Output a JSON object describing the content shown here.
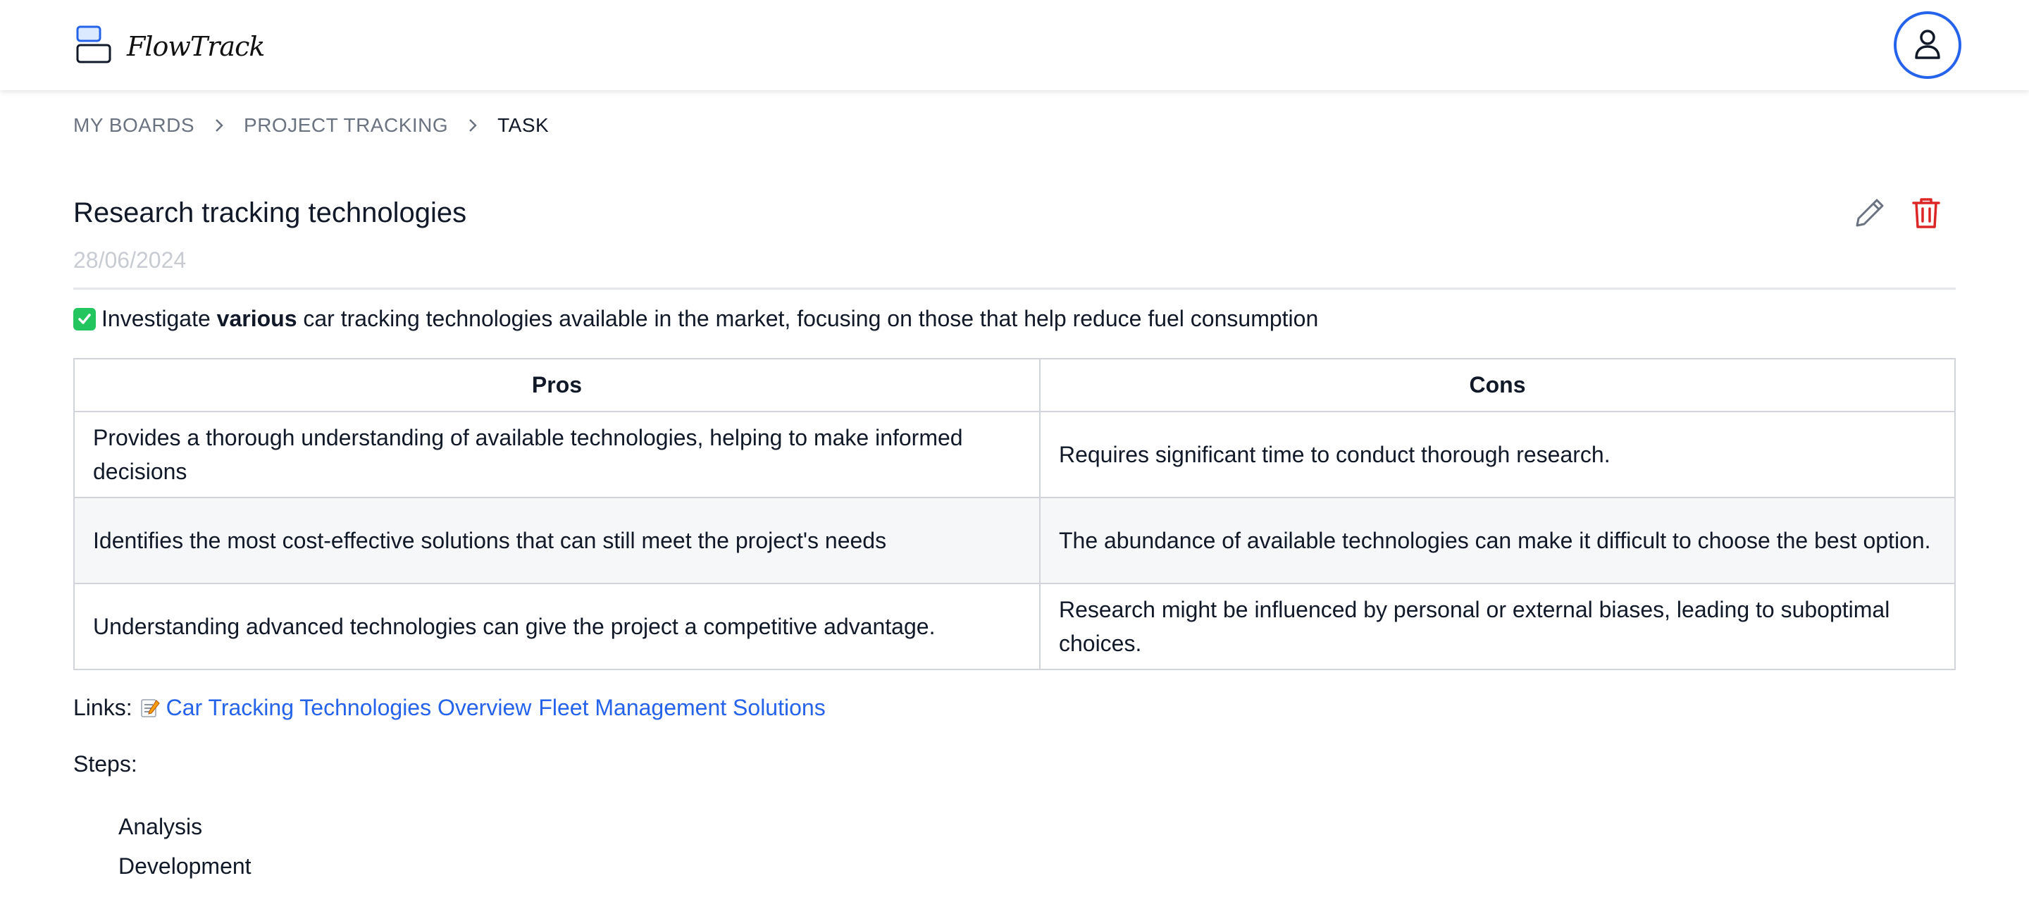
{
  "app": {
    "name": "FlowTrack",
    "logo_icon": "stacked-boxes-icon",
    "accent_color": "#2563eb",
    "user_icon": "user-icon"
  },
  "breadcrumb": {
    "items": [
      "MY BOARDS",
      "PROJECT TRACKING",
      "TASK"
    ],
    "separator_icon": "chevron-right-icon"
  },
  "task": {
    "title": "Research tracking technologies",
    "date": "28/06/2024",
    "actions": {
      "edit_icon": "pencil-icon",
      "delete_icon": "trash-icon",
      "delete_color": "#dc2626"
    },
    "description": {
      "icon": "check-mark-button-emoji",
      "prefix": "Investigate ",
      "bold": "various",
      "suffix": " car tracking technologies available in the market, focusing on those that help reduce fuel consumption"
    },
    "table": {
      "headers": [
        "Pros",
        "Cons"
      ],
      "rows": [
        [
          "Provides a thorough understanding of available technologies, helping to make informed decisions",
          "Requires significant time to conduct thorough research."
        ],
        [
          "Identifies the most cost-effective solutions that can still meet the project's needs",
          "The abundance of available technologies can make it difficult to choose the best option."
        ],
        [
          "Understanding advanced technologies can give the project a competitive advantage.",
          "Research might be influenced by personal or external biases, leading to suboptimal choices."
        ]
      ]
    },
    "links": {
      "label": "Links:",
      "icon": "memo-emoji",
      "items": [
        "Car Tracking Technologies Overview",
        "Fleet Management Solutions"
      ]
    },
    "steps": {
      "label": "Steps:",
      "items": [
        "Analysis",
        "Development"
      ]
    }
  }
}
